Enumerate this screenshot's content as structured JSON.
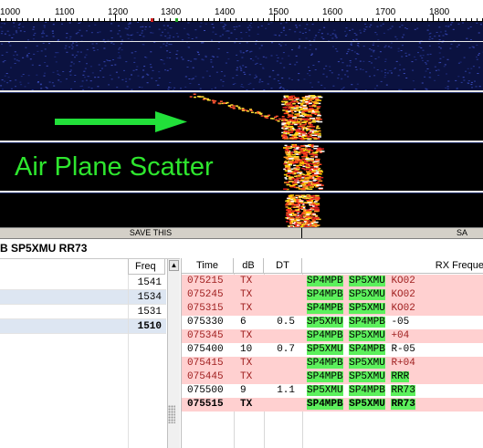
{
  "scale": {
    "ticks": [
      "1000",
      "1100",
      "1200",
      "1300",
      "1400",
      "1500",
      "1600",
      "1700",
      "1800"
    ]
  },
  "overlay": {
    "label": "Air Plane Scatter",
    "arrow_color": "#22e03a",
    "label_color": "#2ee62e"
  },
  "save_bar": {
    "left_label": "SAVE THIS",
    "right_label": "SA"
  },
  "message_line": "B SP5XMU RR73",
  "left_panel": {
    "header": "Freq",
    "scroll_up_icon": "triangle-up-icon",
    "rows": [
      {
        "freq": "1541",
        "alt": false,
        "bold": false
      },
      {
        "freq": "1534",
        "alt": true,
        "bold": false
      },
      {
        "freq": "1531",
        "alt": false,
        "bold": false
      },
      {
        "freq": "1510",
        "alt": true,
        "bold": true
      }
    ]
  },
  "rx_table": {
    "headers": {
      "time": "Time",
      "db": "dB",
      "dt": "DT",
      "rx_freq": "RX Freque"
    },
    "rows": [
      {
        "time": "075215",
        "db": "TX",
        "dt": "",
        "c1": "SP4MPB",
        "c2": "SP5XMU",
        "c3": "KO02",
        "kind": "tx",
        "hl3": false
      },
      {
        "time": "075245",
        "db": "TX",
        "dt": "",
        "c1": "SP4MPB",
        "c2": "SP5XMU",
        "c3": "KO02",
        "kind": "tx",
        "hl3": false
      },
      {
        "time": "075315",
        "db": "TX",
        "dt": "",
        "c1": "SP4MPB",
        "c2": "SP5XMU",
        "c3": "KO02",
        "kind": "tx",
        "hl3": false
      },
      {
        "time": "075330",
        "db": "6",
        "dt": "0.5",
        "c1": "SP5XMU",
        "c2": "SP4MPB",
        "c3": "-05",
        "kind": "rx",
        "hl3": false
      },
      {
        "time": "075345",
        "db": "TX",
        "dt": "",
        "c1": "SP4MPB",
        "c2": "SP5XMU",
        "c3": "+04",
        "kind": "tx",
        "hl3": false
      },
      {
        "time": "075400",
        "db": "10",
        "dt": "0.7",
        "c1": "SP5XMU",
        "c2": "SP4MPB",
        "c3": "R-05",
        "kind": "rx",
        "hl3": false
      },
      {
        "time": "075415",
        "db": "TX",
        "dt": "",
        "c1": "SP4MPB",
        "c2": "SP5XMU",
        "c3": "R+04",
        "kind": "tx",
        "hl3": false
      },
      {
        "time": "075445",
        "db": "TX",
        "dt": "",
        "c1": "SP4MPB",
        "c2": "SP5XMU",
        "c3": "RRR",
        "kind": "tx",
        "hl3": true
      },
      {
        "time": "075500",
        "db": "9",
        "dt": "1.1",
        "c1": "SP5XMU",
        "c2": "SP4MPB",
        "c3": "RR73",
        "kind": "rx",
        "hl3": true
      },
      {
        "time": "075515",
        "db": "TX",
        "dt": "",
        "c1": "SP4MPB",
        "c2": "SP5XMU",
        "c3": "RR73",
        "kind": "tx-bold",
        "hl3": true
      }
    ]
  },
  "colors": {
    "tx_row": "#ffd0d0",
    "callsign_highlight": "#5cf05c",
    "selected_row": "#dde6f2"
  }
}
